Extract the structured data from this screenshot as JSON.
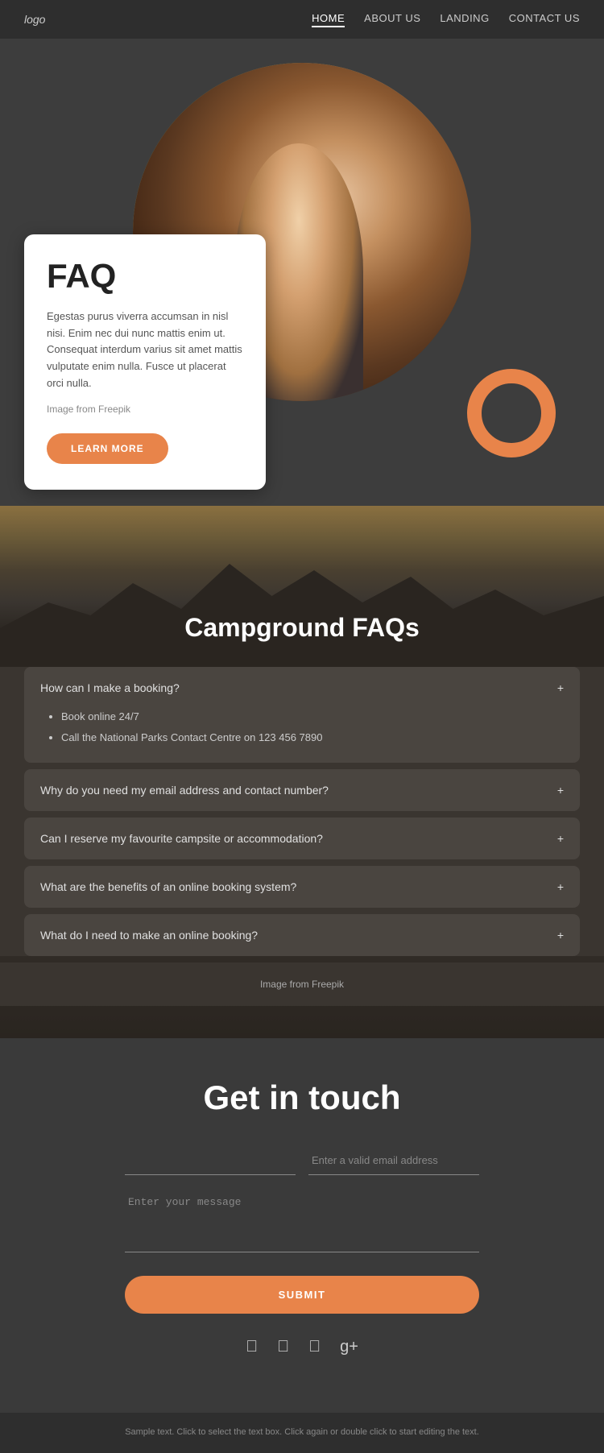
{
  "nav": {
    "logo": "logo",
    "links": [
      {
        "label": "HOME",
        "active": true
      },
      {
        "label": "ABOUT US",
        "active": false
      },
      {
        "label": "LANDING",
        "active": false
      },
      {
        "label": "CONTACT US",
        "active": false
      }
    ]
  },
  "hero": {
    "faq_title": "FAQ",
    "faq_description": "Egestas purus viverra accumsan in nisl nisi. Enim nec dui nunc mattis enim ut. Consequat interdum varius sit amet mattis vulputate enim nulla. Fusce ut placerat orci nulla.",
    "image_credit": "Image from Freepik",
    "learn_more_label": "LEARN MORE"
  },
  "campground_faq": {
    "title": "Campground FAQs",
    "items": [
      {
        "question": "How can I make a booking?",
        "expanded": true,
        "answer_bullets": [
          "Book online 24/7",
          "Call the National Parks Contact Centre on 123 456 7890"
        ]
      },
      {
        "question": "Why do you need my email address and contact number?",
        "expanded": false,
        "answer_bullets": []
      },
      {
        "question": "Can I reserve my favourite campsite or accommodation?",
        "expanded": false,
        "answer_bullets": []
      },
      {
        "question": "What are the benefits of an online booking system?",
        "expanded": false,
        "answer_bullets": []
      },
      {
        "question": "What do I need to make an online booking?",
        "expanded": false,
        "answer_bullets": []
      }
    ],
    "image_credit_text": "Image from ",
    "image_credit_link": "Freepik"
  },
  "contact": {
    "title": "Get in touch",
    "name_placeholder": "",
    "email_placeholder": "Enter a valid email address",
    "message_placeholder": "Enter your message",
    "submit_label": "SUBMIT"
  },
  "social": {
    "icons": [
      "f",
      "t",
      "ig",
      "g+"
    ]
  },
  "footer": {
    "text": "Sample text. Click to select the text box. Click again or double click to start editing the text."
  }
}
